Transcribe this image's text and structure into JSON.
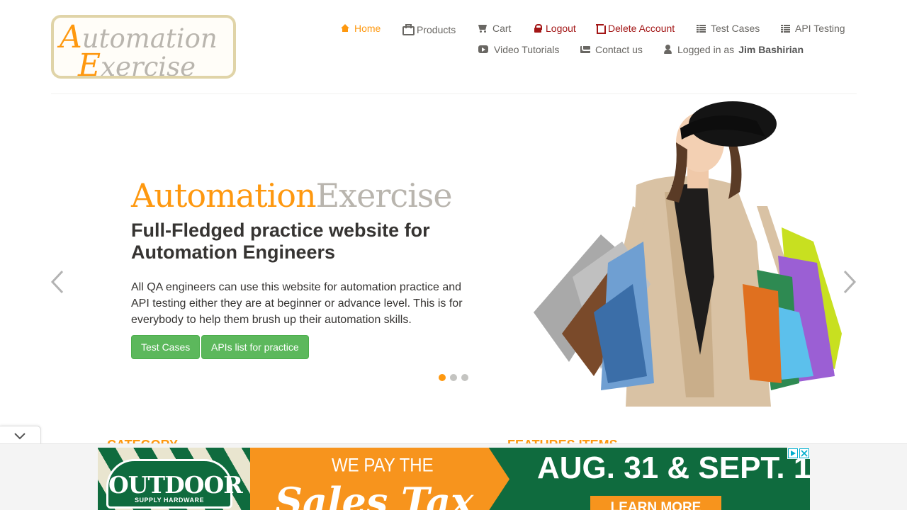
{
  "header": {
    "logo": {
      "line1_cap": "A",
      "line1_rest": "utomation",
      "line2_cap": "E",
      "line2_rest": "xercise"
    },
    "nav": {
      "home": "Home",
      "products": "Products",
      "cart": "Cart",
      "logout": "Logout",
      "delete_account": "Delete Account",
      "test_cases": "Test Cases",
      "api_testing": "API Testing",
      "video_tutorials": "Video Tutorials",
      "contact_us": "Contact us",
      "logged_in_prefix": "Logged in as",
      "logged_in_user": "Jim Bashirian"
    }
  },
  "slider": {
    "title_part1": "Automation",
    "title_part2": "Exercise",
    "subtitle": "Full-Fledged practice website for Automation Engineers",
    "description": "All QA engineers can use this website for automation practice and API testing either they are at beginner or advance level. This is for everybody to help them brush up their automation skills.",
    "button_test_cases": "Test Cases",
    "button_apis": "APIs list for practice",
    "active_slide": 1,
    "slide_count": 3
  },
  "sections": {
    "category": "CATEGORY",
    "features": "FEATURES ITEMS"
  },
  "ad": {
    "brand": "OUTDOOR",
    "brand_sub": "SUPPLY HARDWARE",
    "headline": "WE PAY THE",
    "script": "Sales Tax",
    "dates": "AUG. 31 & SEPT. 1",
    "cta": "LEARN MORE"
  },
  "colors": {
    "accent": "#fe980f",
    "danger": "#a31616",
    "button_green": "#5cb85c",
    "ad_green": "#0f6b3e",
    "ad_orange": "#f7941d"
  }
}
